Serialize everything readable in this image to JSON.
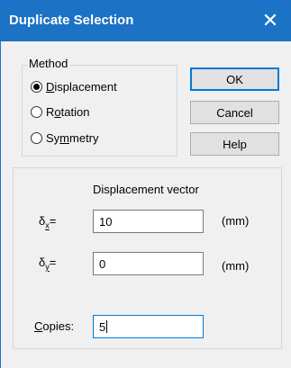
{
  "window": {
    "title": "Duplicate Selection",
    "close_glyph": "✕"
  },
  "method_group": {
    "legend": "Method",
    "options": [
      {
        "label": "Displacement",
        "mnemonic": "D",
        "rest": "isplacement",
        "checked": true
      },
      {
        "label": "Rotation",
        "pre": "R",
        "mnemonic": "o",
        "rest": "tation",
        "checked": false
      },
      {
        "label": "Symmetry",
        "pre": "Sy",
        "mnemonic": "m",
        "rest": "metry",
        "checked": false
      }
    ]
  },
  "buttons": {
    "ok": "OK",
    "cancel": "Cancel",
    "help": "Help"
  },
  "vector": {
    "heading": "Displacement vector",
    "dx": {
      "symbol": "δ",
      "sub": "x",
      "eq": "=",
      "value": "10",
      "unit": "(mm)"
    },
    "dy": {
      "symbol": "δ",
      "sub": "y",
      "eq": "=",
      "value": "0",
      "unit": "(mm)"
    }
  },
  "copies": {
    "mnemonic": "C",
    "rest": "opies:",
    "value": "5"
  }
}
